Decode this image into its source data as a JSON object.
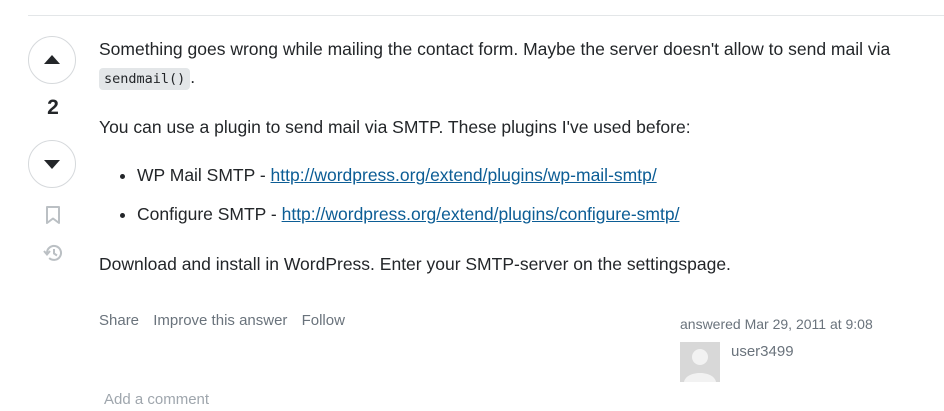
{
  "vote": {
    "score": "2"
  },
  "post": {
    "p1_text": "Something goes wrong while mailing the contact form. Maybe the server doesn't allow to send mail via ",
    "p1_code": "sendmail()",
    "p1_end": ".",
    "p2": "You can use a plugin to send mail via SMTP. These plugins I've used before:",
    "plugins": [
      {
        "name": "WP Mail SMTP - ",
        "url": "http://wordpress.org/extend/plugins/wp-mail-smtp/"
      },
      {
        "name": "Configure SMTP - ",
        "url": "http://wordpress.org/extend/plugins/configure-smtp/"
      }
    ],
    "p3": "Download and install in WordPress. Enter your SMTP-server on the settingspage."
  },
  "menu": {
    "share": "Share",
    "improve": "Improve this answer",
    "follow": "Follow"
  },
  "signature": {
    "time": "answered Mar 29, 2011 at 9:08",
    "user": "user3499"
  },
  "comments": {
    "add": "Add a comment"
  },
  "icons": {
    "up": "upvote-arrow-icon",
    "down": "downvote-arrow-icon",
    "bookmark": "bookmark-icon",
    "history": "history-icon"
  }
}
